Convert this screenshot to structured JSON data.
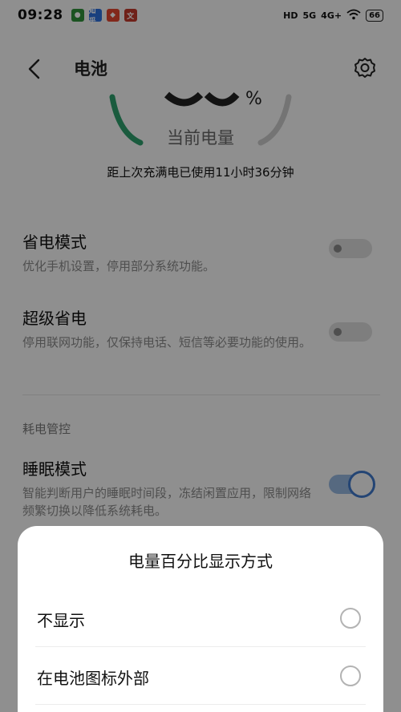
{
  "status": {
    "time": "09:28",
    "notif_zhihu": "知乎",
    "notif_doc": "文",
    "sys_hd": "HD",
    "sys_5g": "5G",
    "sys_4g": "4G+",
    "battery": "66"
  },
  "header": {
    "title": "电池"
  },
  "battery": {
    "percent_symbol": "%",
    "label": "当前电量",
    "usage_text": "距上次充满电已使用11小时36分钟"
  },
  "settings": {
    "power_saving": {
      "title": "省电模式",
      "desc": "优化手机设置，停用部分系统功能。"
    },
    "super_saving": {
      "title": "超级省电",
      "desc": "停用联网功能，仅保持电话、短信等必要功能的使用。"
    },
    "section_label": "耗电管控",
    "sleep_mode": {
      "title": "睡眠模式",
      "desc": "智能判断用户的睡眠时间段，冻结闲置应用，限制网络频繁切换以降低系统耗电。"
    }
  },
  "sheet": {
    "title": "电量百分比显示方式",
    "options": [
      {
        "label": "不显示"
      },
      {
        "label": "在电池图标外部"
      }
    ]
  },
  "colors": {
    "accent": "#3f77c9",
    "gauge_fill": "#2e9e6b"
  }
}
